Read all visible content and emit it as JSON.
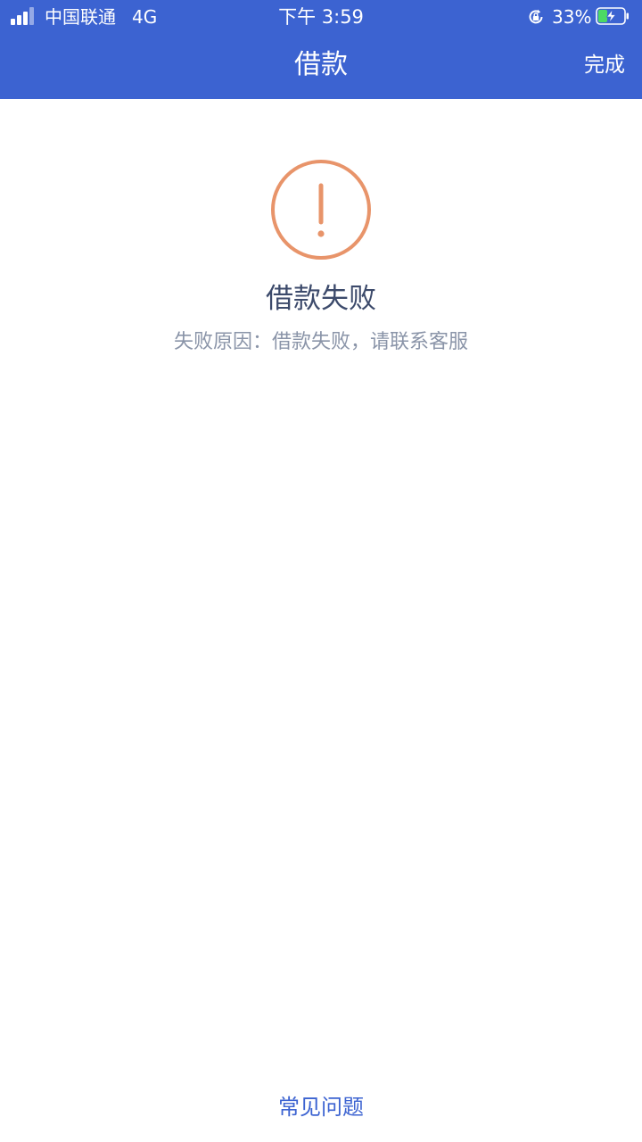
{
  "status_bar": {
    "carrier": "中国联通",
    "network": "4G",
    "time": "下午 3:59",
    "battery_percent": "33%"
  },
  "nav": {
    "title": "借款",
    "done_label": "完成"
  },
  "result": {
    "title": "借款失败",
    "reason": "失败原因：借款失败，请联系客服"
  },
  "footer": {
    "faq_label": "常见问题"
  },
  "colors": {
    "brand": "#3c63d1",
    "warning": "#e8946a",
    "battery_charging": "#4cd964"
  },
  "icons": {
    "signal": "signal-bars-icon",
    "orientation_lock": "orientation-lock-icon",
    "battery": "battery-charging-icon",
    "result": "warning-exclamation-circle-icon"
  }
}
